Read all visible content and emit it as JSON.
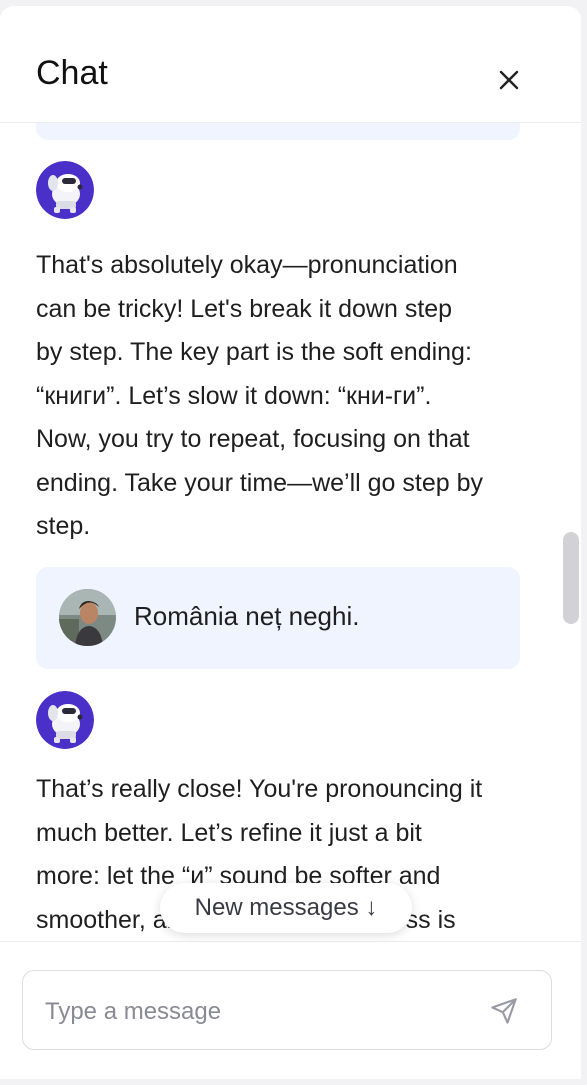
{
  "header": {
    "title": "Chat",
    "close_icon": "close-icon"
  },
  "messages": [
    {
      "sender": "bot",
      "avatar_icon": "robot-dog-avatar",
      "text": "That's absolutely okay—pronunciation\ncan be tricky! Let's break it down step\nby step. The key part is the soft ending:\n“книги”. Let’s slow it down: “кни-ги”.\nNow, you try to repeat, focusing on that\nending. Take your time—we’ll go step by\nstep."
    },
    {
      "sender": "user",
      "avatar_icon": "user-photo-avatar",
      "text": "România neț neghi."
    },
    {
      "sender": "bot",
      "avatar_icon": "robot-dog-avatar",
      "text": "That’s really close! You're pronouncing it\nmuch better. Let’s refine it just a bit\nmore: let the “и” sound be softer and\nsmoother, and remember the stress is"
    }
  ],
  "new_messages": {
    "label": "New messages ↓"
  },
  "composer": {
    "placeholder": "Type a message",
    "value": "",
    "send_icon": "send-icon"
  },
  "colors": {
    "user_bubble": "#f0f4ff",
    "bot_avatar_bg": "#4a2fc9",
    "text": "#1f1f1f"
  }
}
